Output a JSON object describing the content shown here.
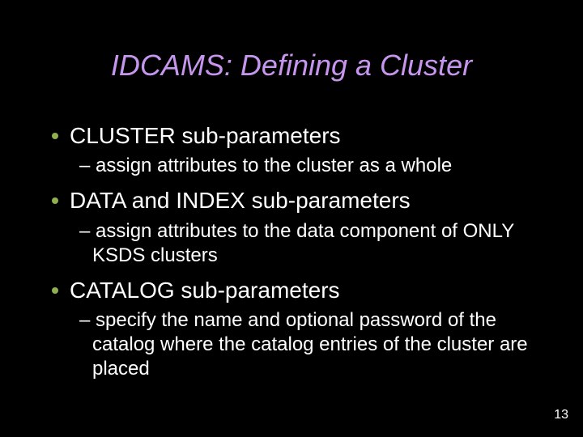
{
  "title": "IDCAMS: Defining a Cluster",
  "bullets": [
    {
      "text": "CLUSTER sub-parameters",
      "sub": [
        "assign attributes to the cluster as a whole"
      ]
    },
    {
      "text": "DATA and INDEX sub-parameters",
      "sub": [
        "assign attributes to the data component of ONLY KSDS clusters"
      ]
    },
    {
      "text": "CATALOG sub-parameters",
      "sub": [
        "specify the name and optional password of the catalog where the catalog entries of the cluster are placed"
      ]
    }
  ],
  "page_number": "13",
  "colors": {
    "background": "#000000",
    "title": "#c696ee",
    "body_text": "#ffffff",
    "bullet": "#90b050"
  }
}
